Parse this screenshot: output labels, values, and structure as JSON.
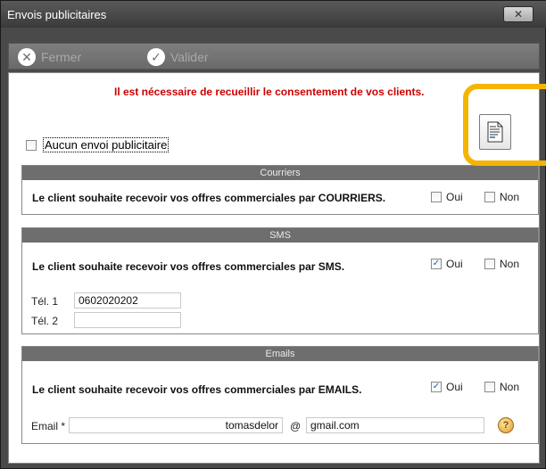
{
  "window": {
    "title": "Envois publicitaires",
    "close_icon": "close-icon"
  },
  "toolbar": {
    "close_label": "Fermer",
    "validate_label": "Valider"
  },
  "notice": "Il est nécessaire de recueillir le consentement de vos clients.",
  "no_ads": {
    "label": "Aucun envoi publicitaire",
    "checked": false
  },
  "sections": {
    "mail": {
      "header": "Courriers",
      "question": "Le client souhaite recevoir vos offres commerciales par COURRIERS.",
      "oui": "Oui",
      "non": "Non",
      "oui_checked": false,
      "non_checked": false
    },
    "sms": {
      "header": "SMS",
      "question": "Le client souhaite recevoir vos offres commerciales par SMS.",
      "oui": "Oui",
      "non": "Non",
      "oui_checked": true,
      "non_checked": false,
      "tel1_label": "Tél. 1",
      "tel1_value": "0602020202",
      "tel2_label": "Tél. 2",
      "tel2_value": ""
    },
    "email": {
      "header": "Emails",
      "question": "Le client souhaite recevoir vos offres commerciales par EMAILS.",
      "oui": "Oui",
      "non": "Non",
      "oui_checked": true,
      "non_checked": false,
      "email_label": "Email *",
      "email_user": "tomasdelor",
      "at": "@",
      "email_domain": "gmail.com"
    }
  },
  "colors": {
    "notice": "#cc0000",
    "highlight": "#f5b400",
    "section_header": "#6e6e6e"
  }
}
